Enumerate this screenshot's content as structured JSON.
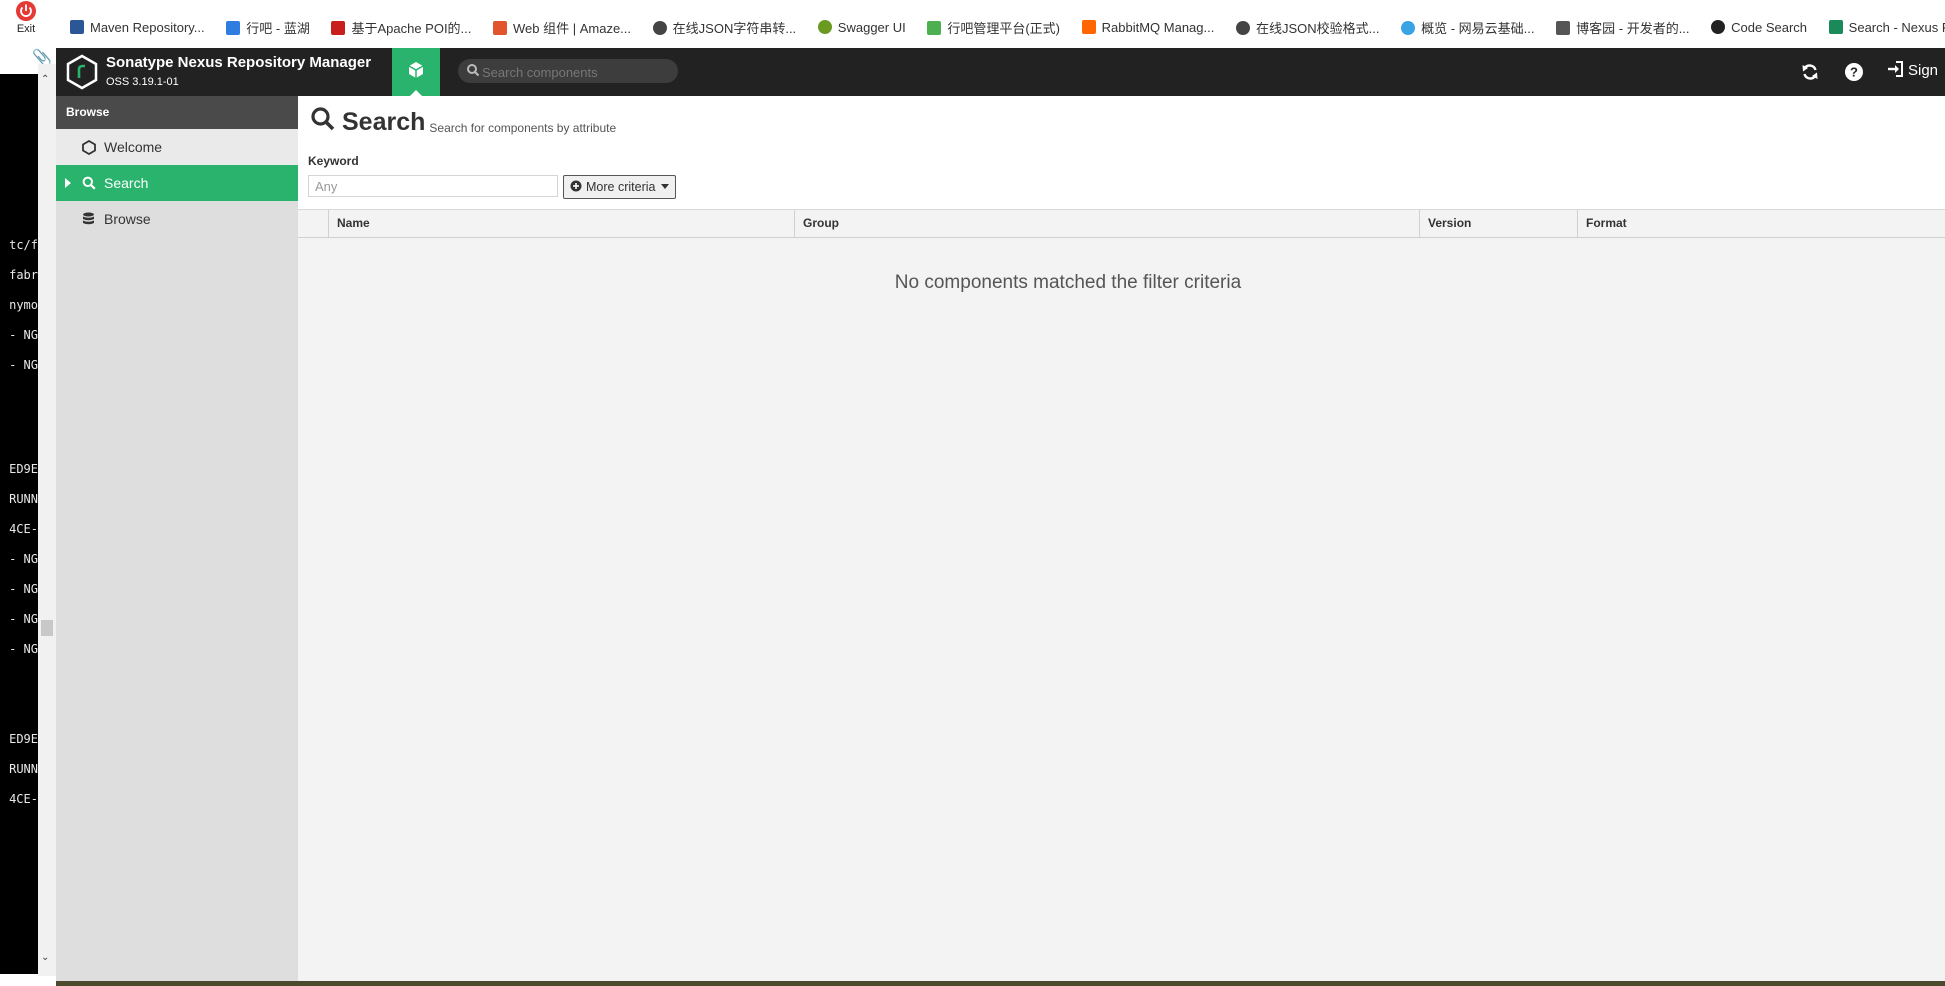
{
  "exit": {
    "label": "Exit"
  },
  "bookmarks": [
    {
      "label": "Maven Repository...",
      "color": "#2b5797"
    },
    {
      "label": "行吧 - 蓝湖",
      "color": "#2f7de1"
    },
    {
      "label": "基于Apache POI的...",
      "color": "#c81e1e"
    },
    {
      "label": "Web 组件 | Amaze...",
      "color": "#e2542b"
    },
    {
      "label": "在线JSON字符串转...",
      "color": "#444444"
    },
    {
      "label": "Swagger UI",
      "color": "#6a9a1f"
    },
    {
      "label": "行吧管理平台(正式)",
      "color": "#4caf50"
    },
    {
      "label": "RabbitMQ Manag...",
      "color": "#ff6600"
    },
    {
      "label": "在线JSON校验格式...",
      "color": "#444444"
    },
    {
      "label": "概览 - 网易云基础...",
      "color": "#3aa3e3"
    },
    {
      "label": "博客园 - 开发者的...",
      "color": "#555555"
    },
    {
      "label": "Code Search",
      "color": "#222222"
    },
    {
      "label": "Search - Nexus R...",
      "color": "#1b8a5a"
    }
  ],
  "terminal": {
    "lines": [
      "tc/f",
      "fabr",
      "nymo",
      "NG -",
      "NG -",
      "",
      "",
      "ED9E",
      "RUNN",
      "-4CE",
      "NG -",
      "NG -",
      "NG -",
      "NG -",
      "",
      "",
      "ED9E",
      "RUNN",
      "-4CE"
    ]
  },
  "header": {
    "title": "Sonatype Nexus Repository Manager",
    "version": "OSS 3.19.1-01",
    "search_placeholder": "Search components",
    "signin_label": "Sign"
  },
  "nav": {
    "heading": "Browse",
    "items": [
      {
        "label": "Welcome"
      },
      {
        "label": "Search"
      },
      {
        "label": "Browse"
      }
    ]
  },
  "main": {
    "title": "Search",
    "subtitle": "Search for components by attribute",
    "keyword_label": "Keyword",
    "keyword_placeholder": "Any",
    "more_criteria_label": "More criteria",
    "columns": [
      "Name",
      "Group",
      "Version",
      "Format"
    ],
    "empty_message": "No components matched the filter criteria"
  },
  "colors": {
    "accent": "#2ab36d",
    "header_bg": "#222222",
    "nav_heading_bg": "#4a4a4a"
  }
}
